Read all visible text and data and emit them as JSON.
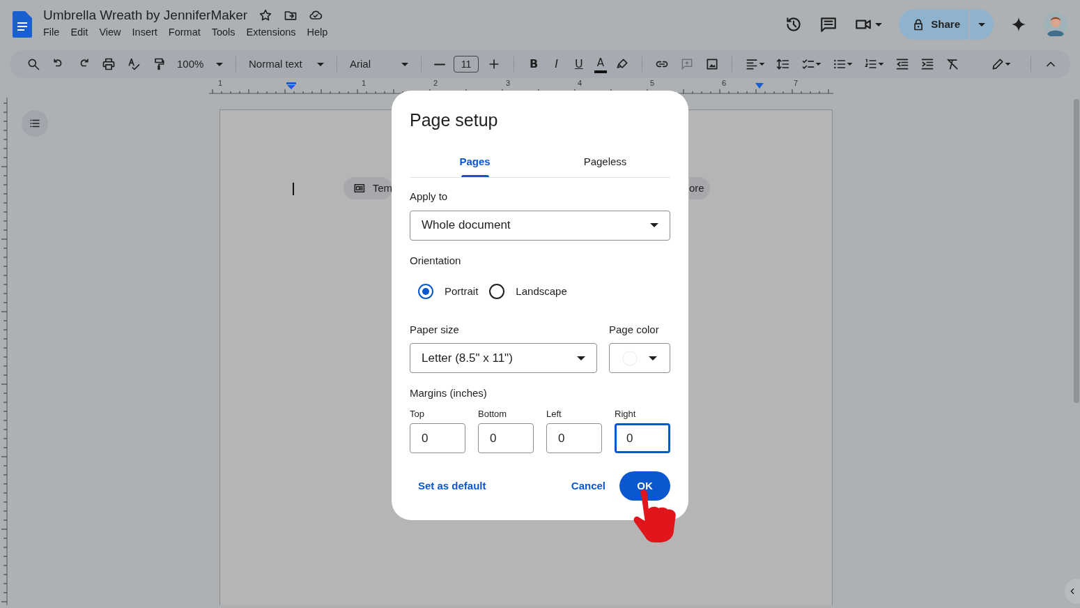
{
  "document": {
    "title": "Umbrella Wreath by JenniferMaker",
    "menu": [
      "File",
      "Edit",
      "View",
      "Insert",
      "Format",
      "Tools",
      "Extensions",
      "Help"
    ]
  },
  "header": {
    "share_button": "Share"
  },
  "toolbar": {
    "zoom": "100%",
    "style": "Normal text",
    "font": "Arial",
    "font_size": "11",
    "format_buttons": [
      "B",
      "I",
      "U"
    ],
    "text_color": "A"
  },
  "ruler": {
    "labels": [
      "1",
      "1",
      "2",
      "3",
      "4",
      "5",
      "6",
      "7"
    ]
  },
  "page": {
    "chips": [
      "Tem",
      "ore"
    ]
  },
  "dialog": {
    "title": "Page setup",
    "tabs": [
      {
        "label": "Pages",
        "selected": true
      },
      {
        "label": "Pageless",
        "selected": false
      }
    ],
    "apply_to": {
      "label": "Apply to",
      "value": "Whole document"
    },
    "orientation": {
      "label": "Orientation",
      "options": [
        {
          "label": "Portrait",
          "selected": true
        },
        {
          "label": "Landscape",
          "selected": false
        }
      ]
    },
    "paper_size": {
      "label": "Paper size",
      "value": "Letter (8.5\" x 11\")"
    },
    "page_color": {
      "label": "Page color"
    },
    "margins": {
      "label": "Margins (inches)",
      "fields": [
        {
          "label": "Top",
          "value": "0",
          "focused": false
        },
        {
          "label": "Bottom",
          "value": "0",
          "focused": false
        },
        {
          "label": "Left",
          "value": "0",
          "focused": false
        },
        {
          "label": "Right",
          "value": "0",
          "focused": true
        }
      ]
    },
    "buttons": {
      "set_default": "Set as default",
      "cancel": "Cancel",
      "ok": "OK"
    }
  }
}
